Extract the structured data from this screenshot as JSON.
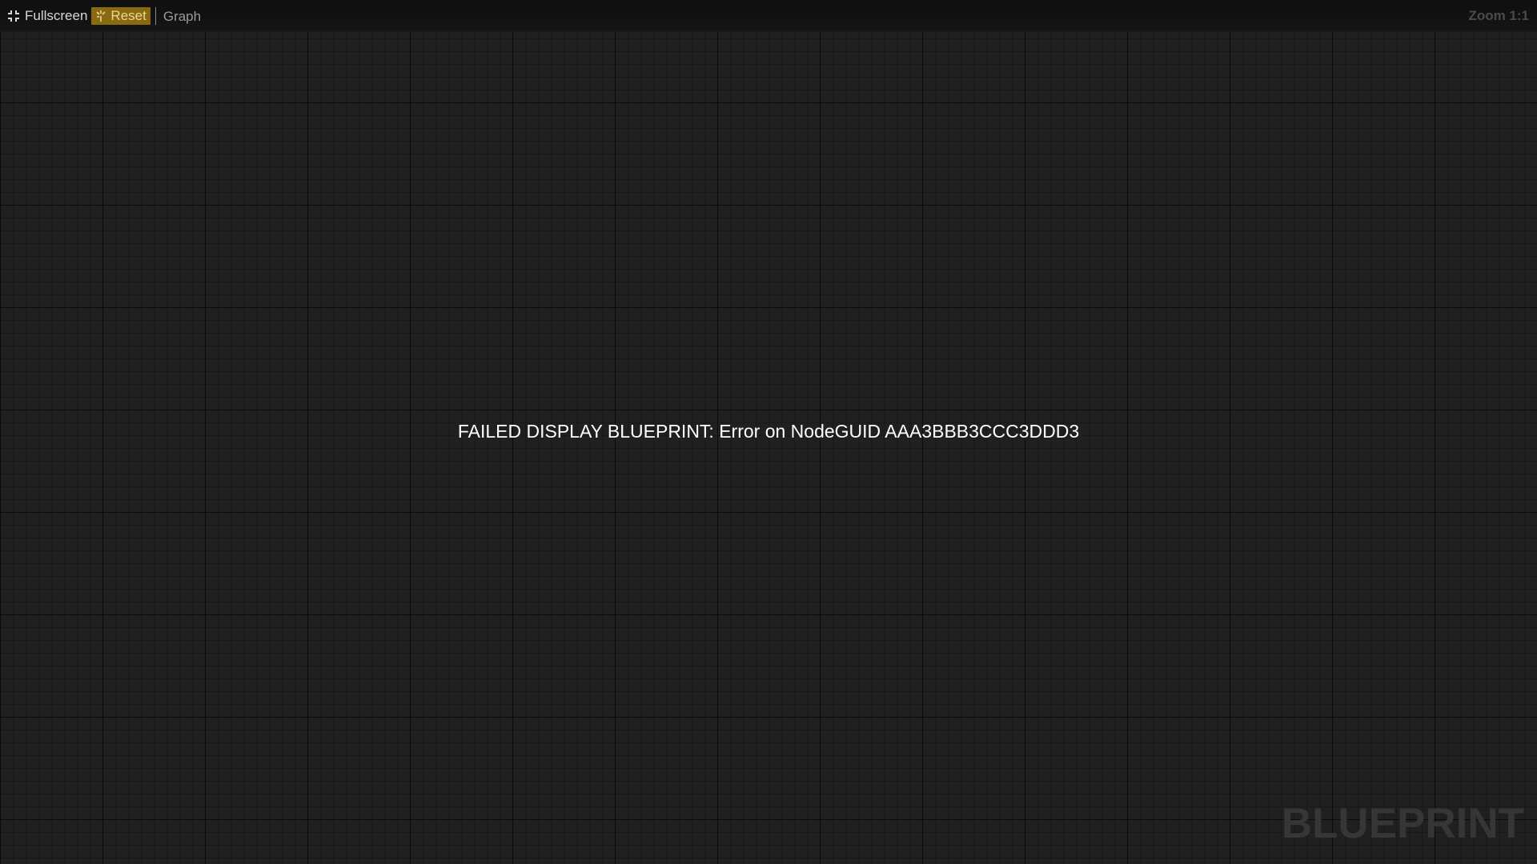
{
  "toolbar": {
    "fullscreen_label": "Fullscreen",
    "reset_label": "Reset",
    "graph_label": "Graph",
    "zoom_label": "Zoom 1:1",
    "icons": {
      "fullscreen": "fullscreen-icon",
      "reset": "reset-icon"
    },
    "colors": {
      "reset_bg": "#8a6a0e",
      "reset_text": "#e8d79a"
    }
  },
  "canvas": {
    "error_message": "FAILED DISPLAY BLUEPRINT: Error on NodeGUID AAA3BBB3CCC3DDD3",
    "watermark": "BLUEPRINT",
    "background_color": "#202020"
  }
}
